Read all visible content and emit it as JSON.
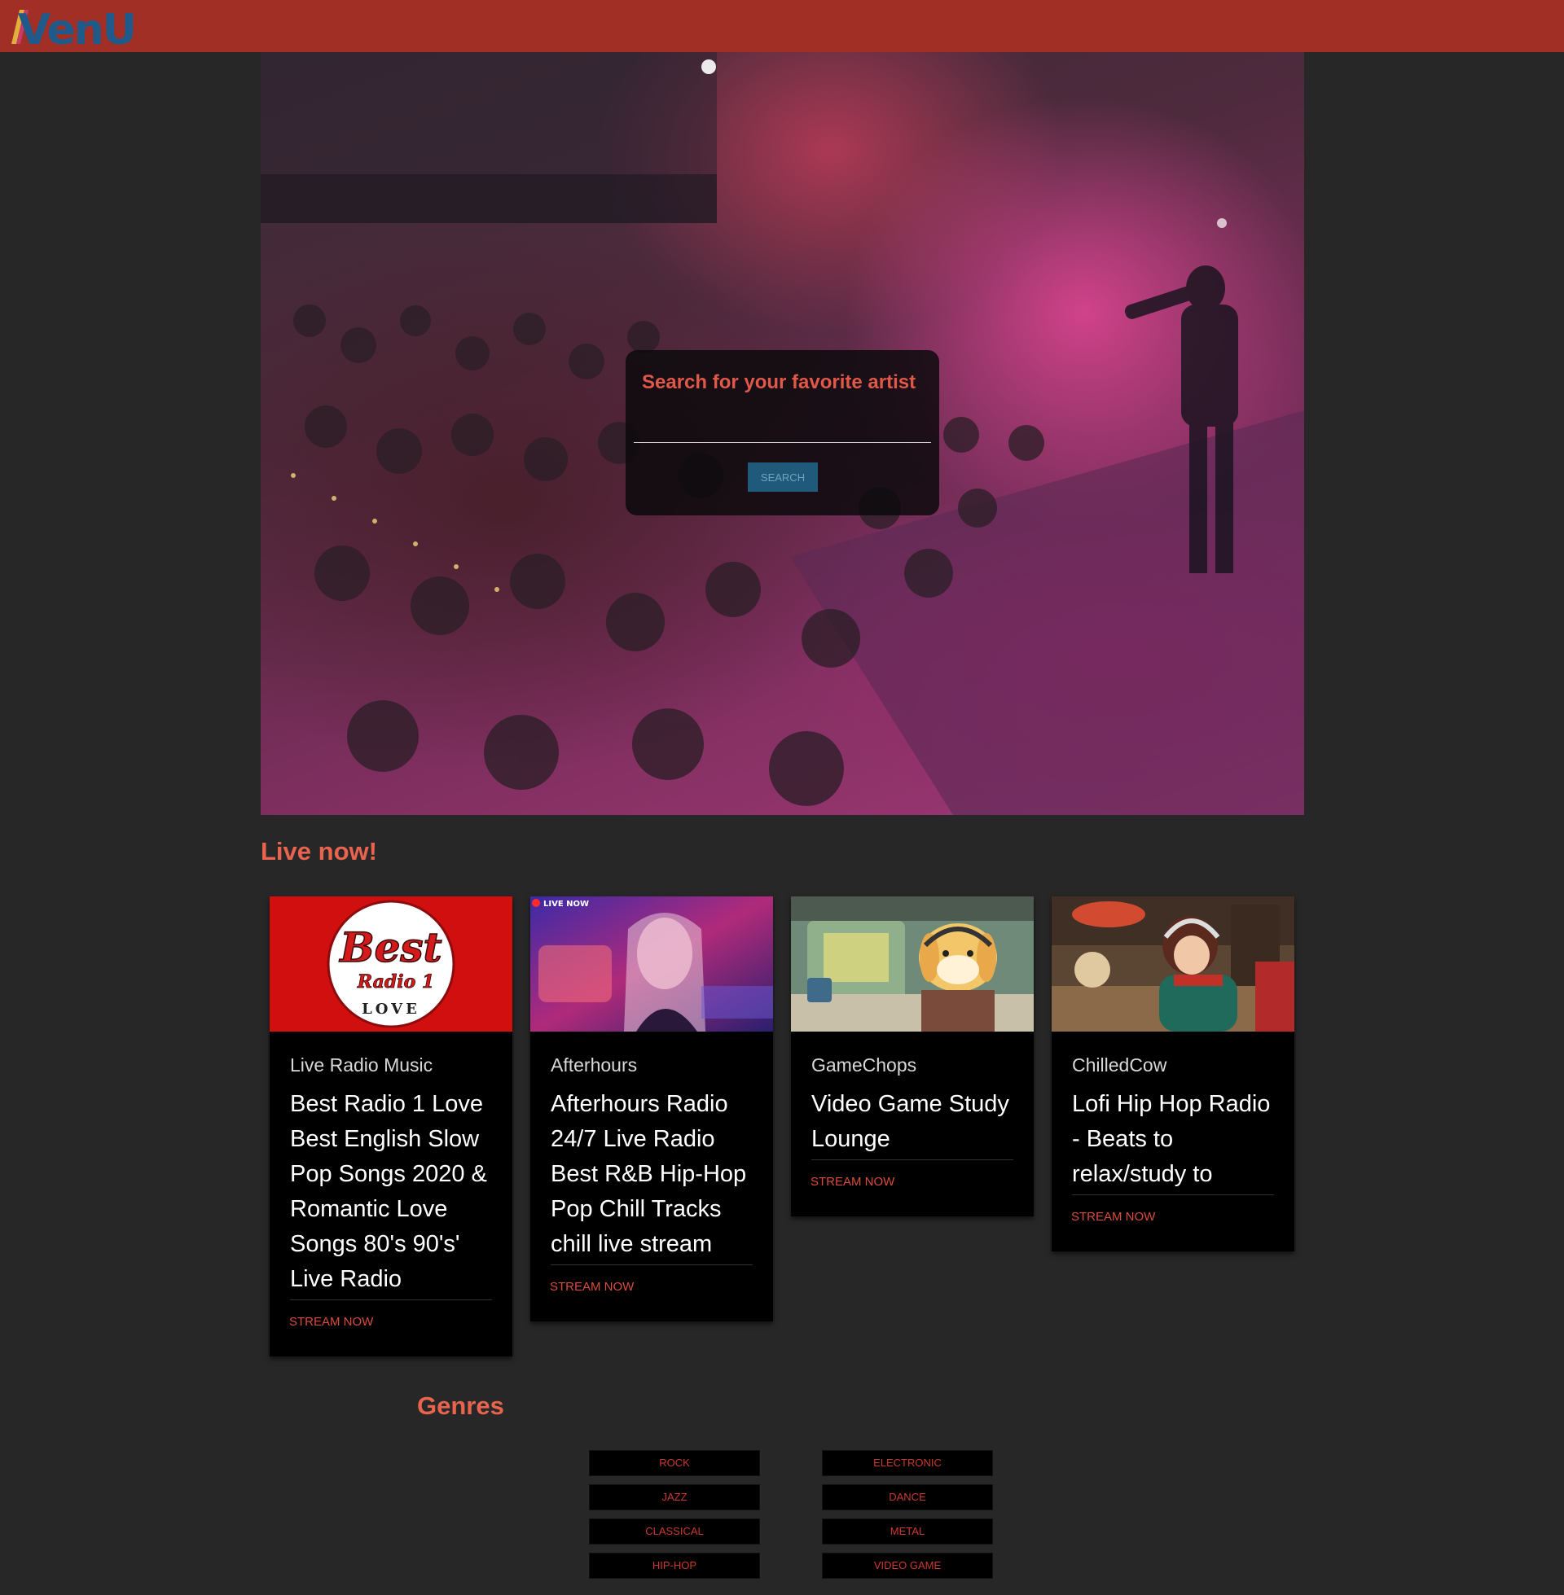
{
  "header": {
    "logo_text": "VenU",
    "accent_color": "#a12f26"
  },
  "hero": {
    "search_label": "Search for your favorite artist",
    "search_input_value": "",
    "search_placeholder": "",
    "search_button": "Search"
  },
  "live": {
    "title": "Live now!",
    "cards": [
      {
        "channel": "Live Radio Music",
        "title": "Best Radio 1 Love Best English Slow Pop Songs 2020 & Romantic Love Songs 80's 90's' Live Radio",
        "action": "Stream Now",
        "thumb_text": [
          "Best",
          "Radio 1",
          "LOVE"
        ]
      },
      {
        "channel": "Afterhours",
        "title": "Afterhours Radio 24/7 Live Radio Best R&B Hip-Hop Pop Chill Tracks chill live stream",
        "action": "Stream Now",
        "thumb_badge": "LIVE NOW"
      },
      {
        "channel": "GameChops",
        "title": "Video Game Study Lounge",
        "action": "Stream Now"
      },
      {
        "channel": "ChilledCow",
        "title": "Lofi Hip Hop Radio - Beats to relax/study to",
        "action": "Stream Now"
      }
    ]
  },
  "genres": {
    "title": "Genres",
    "left": [
      "Rock",
      "Jazz",
      "Classical",
      "Hip-Hop"
    ],
    "right": [
      "Electronic",
      "Dance",
      "Metal",
      "Video Game"
    ]
  }
}
